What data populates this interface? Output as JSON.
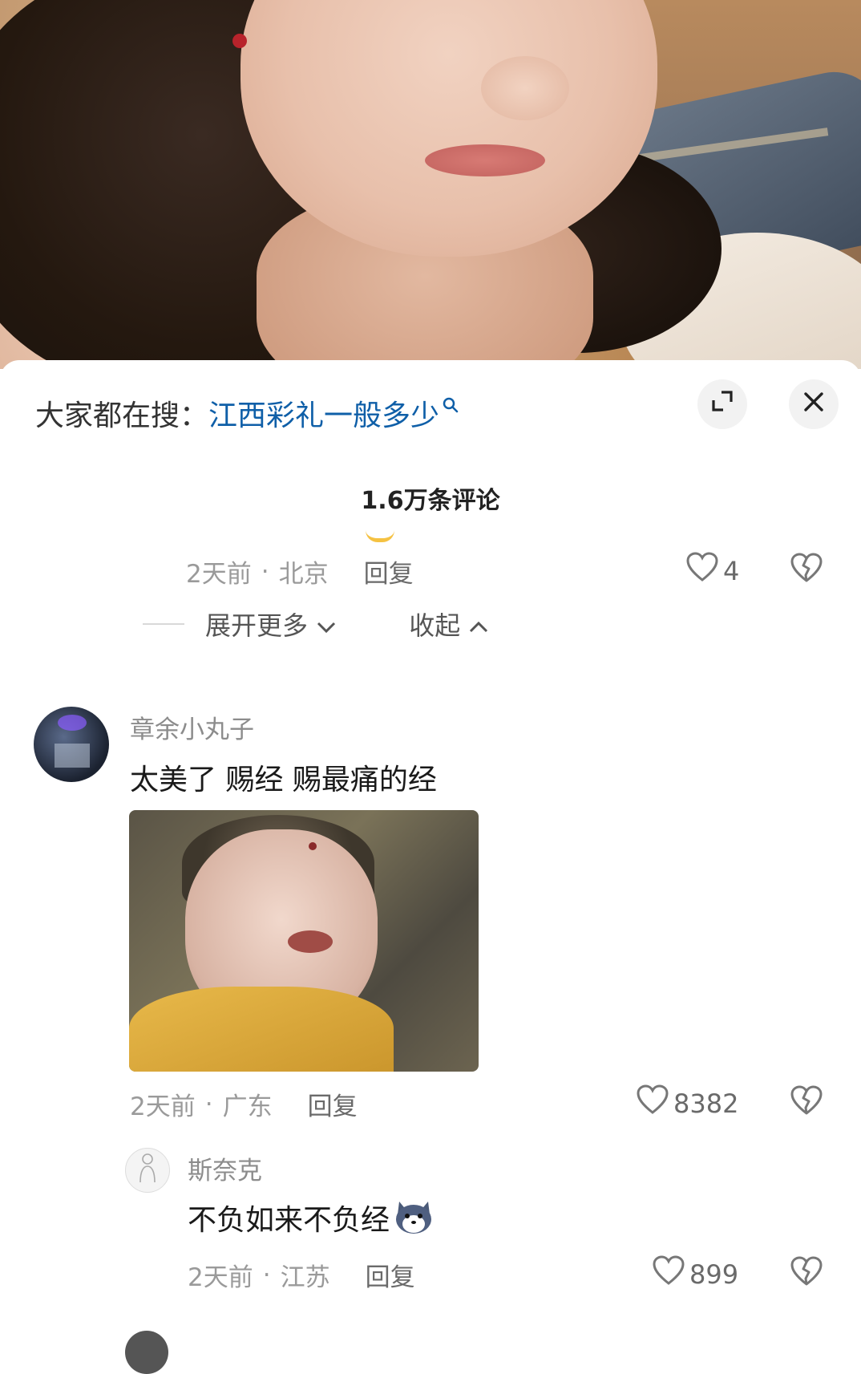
{
  "search_bar": {
    "prefix": "大家都在搜：",
    "keyword": "江西彩礼一般多少"
  },
  "comments_header": {
    "count_label": "1.6万条评论"
  },
  "top_reply": {
    "time": "2天前",
    "location": "北京",
    "reply_label": "回复",
    "likes": "4"
  },
  "thread_controls": {
    "expand_label": "展开更多",
    "collapse_label": "收起"
  },
  "comment": {
    "username": "章余小丸子",
    "text": "太美了 赐经 赐最痛的经",
    "time": "2天前",
    "location": "广东",
    "reply_label": "回复",
    "likes": "8382"
  },
  "reply": {
    "username": "斯奈克",
    "text": "不负如来不负经",
    "time": "2天前",
    "location": "江苏",
    "reply_label": "回复",
    "likes": "899"
  },
  "icons": {
    "search": "search-icon",
    "expand": "expand-icon",
    "close": "close-icon",
    "like": "heart-icon",
    "dislike": "broken-heart-icon"
  },
  "colors": {
    "keyword": "#0f5fa8",
    "accent_indicator": "#f5c242"
  }
}
